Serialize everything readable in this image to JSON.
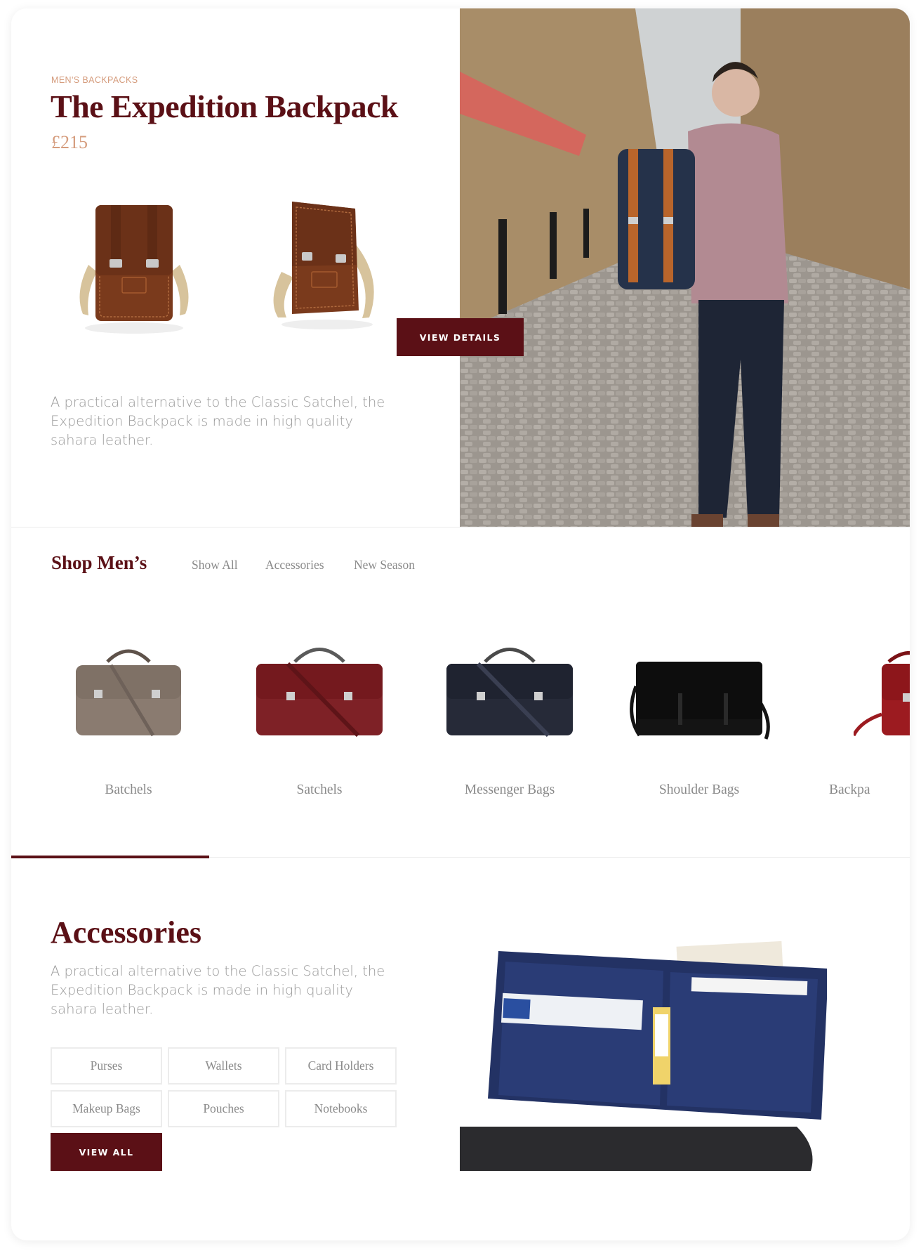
{
  "hero": {
    "eyebrow": "MEN'S BACKPACKS",
    "title": "The Expedition Backpack",
    "price": "£215",
    "description": "A practical alternative to the Classic Satchel, the Expedition Backpack is made in high quality sahara leather.",
    "cta_label": "VIEW DETAILS"
  },
  "shop": {
    "title": "Shop Men’s",
    "tabs": [
      "Show All",
      "Accessories",
      "New Season"
    ],
    "categories": [
      {
        "label": "Batchels",
        "color": "#8a7b70"
      },
      {
        "label": "Satchels",
        "color": "#7e2126"
      },
      {
        "label": "Messenger Bags",
        "color": "#262a38"
      },
      {
        "label": "Shoulder Bags",
        "color": "#141414"
      },
      {
        "label": "Backpa",
        "color": "#9c1b20"
      }
    ],
    "scroll_progress": 0.22
  },
  "accessories": {
    "title": "Accessories",
    "description": "A practical alternative to the Classic Satchel, the Expedition Backpack is made in high quality sahara leather.",
    "chips": [
      "Purses",
      "Wallets",
      "Card Holders",
      "Makeup Bags",
      "Pouches",
      "Notebooks"
    ],
    "cta_label": "VIEW ALL"
  },
  "theme": {
    "brand": "#5b1016",
    "accent": "#d59c7d",
    "muted_text": "#8a8a8a"
  }
}
